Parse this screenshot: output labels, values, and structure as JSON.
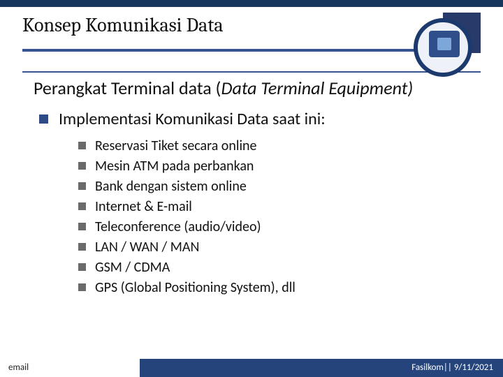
{
  "header": {
    "title": "Konsep Komunikasi Data"
  },
  "section": {
    "run1": "Perangkat Terminal data (",
    "run2": "Data Terminal Equipment)"
  },
  "lvl1": {
    "item": "Implementasi Komunikasi Data saat ini:"
  },
  "lvl2": {
    "items": [
      "Reservasi Tiket secara online",
      "Mesin ATM pada perbankan",
      "Bank dengan sistem online",
      "Internet & E-mail",
      "Teleconference (audio/video)",
      "LAN / WAN / MAN",
      "GSM / CDMA",
      "GPS (Global Positioning System), dll"
    ]
  },
  "footer": {
    "left": "email",
    "right": "Fasilkom|| 9/11/2021"
  }
}
